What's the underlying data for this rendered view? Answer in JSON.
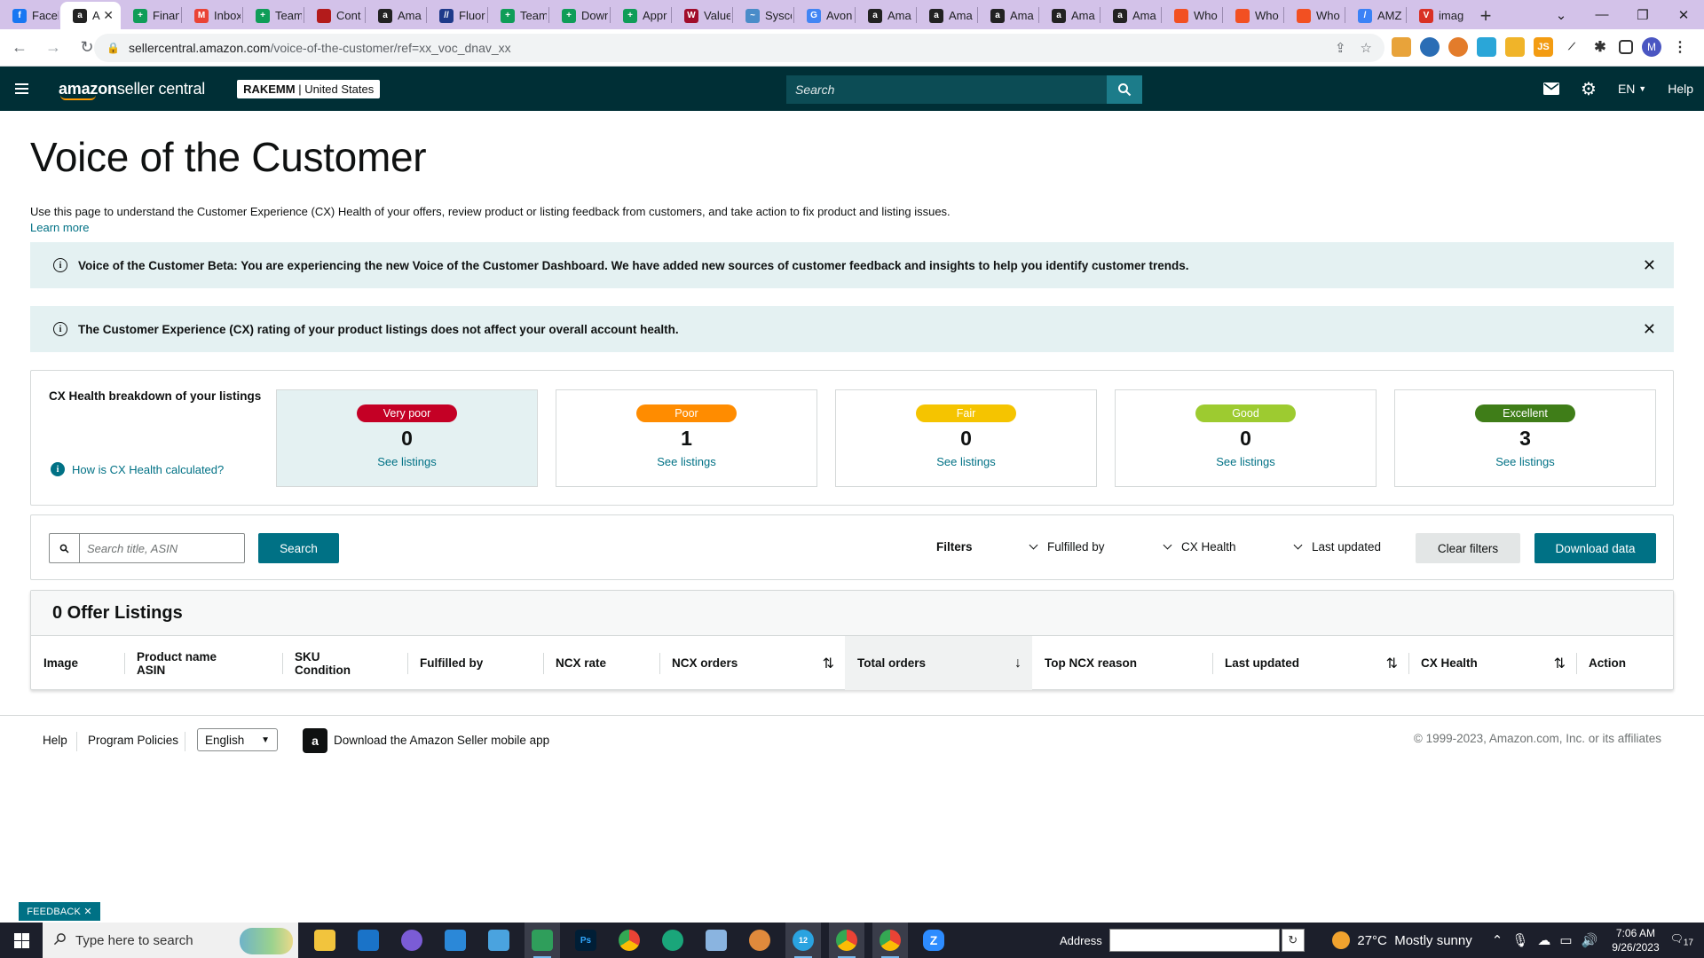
{
  "browser": {
    "tabs": [
      {
        "title": "Faceb",
        "color": "#1877f2",
        "glyph": "f"
      },
      {
        "title": "A",
        "color": "#222222",
        "glyph": "a",
        "active": true
      },
      {
        "title": "Finan",
        "color": "#0f9d58",
        "glyph": "+"
      },
      {
        "title": "Inbox",
        "color": "#ea4335",
        "glyph": "M"
      },
      {
        "title": "Team",
        "color": "#0f9d58",
        "glyph": "+"
      },
      {
        "title": "Cont",
        "color": "#b31b1b",
        "glyph": ""
      },
      {
        "title": "Ama",
        "color": "#222222",
        "glyph": "a"
      },
      {
        "title": "Fluor",
        "color": "#1e3a8a",
        "glyph": "//"
      },
      {
        "title": "Team",
        "color": "#0f9d58",
        "glyph": "+"
      },
      {
        "title": "Down",
        "color": "#0f9d58",
        "glyph": "+"
      },
      {
        "title": "Appr",
        "color": "#0f9d58",
        "glyph": "+"
      },
      {
        "title": "Value",
        "color": "#a10d2b",
        "glyph": "W"
      },
      {
        "title": "Sysco",
        "color": "#4a8cc9",
        "glyph": "~"
      },
      {
        "title": "Avon",
        "color": "#4285f4",
        "glyph": "G"
      },
      {
        "title": "Ama",
        "color": "#222222",
        "glyph": "a"
      },
      {
        "title": "Ama",
        "color": "#222222",
        "glyph": "a"
      },
      {
        "title": "Ama",
        "color": "#222222",
        "glyph": "a"
      },
      {
        "title": "Ama",
        "color": "#222222",
        "glyph": "a"
      },
      {
        "title": "Ama",
        "color": "#222222",
        "glyph": "a"
      },
      {
        "title": "Who",
        "color": "#f25022",
        "glyph": ""
      },
      {
        "title": "Who",
        "color": "#f25022",
        "glyph": ""
      },
      {
        "title": "Who",
        "color": "#f25022",
        "glyph": ""
      },
      {
        "title": "AMZ",
        "color": "#3b82f6",
        "glyph": "/"
      },
      {
        "title": "imag",
        "color": "#d93025",
        "glyph": "V"
      }
    ],
    "url_host": "sellercentral.amazon.com",
    "url_path": "/voice-of-the-customer/ref=xx_voc_dnav_xx",
    "profile_initial": "M"
  },
  "header": {
    "logo_bold": "amazon",
    "logo_rest": " seller central",
    "account_name": "RAKEMM",
    "account_region": "United States",
    "search_placeholder": "Search",
    "language": "EN",
    "help": "Help"
  },
  "page": {
    "title": "Voice of the Customer",
    "description": "Use this page to understand the Customer Experience (CX) Health of your offers, review product or listing feedback from customers, and take action to fix product and listing issues.",
    "learn_more": "Learn more",
    "alerts": [
      {
        "text": "Voice of the Customer Beta: You are experiencing the new Voice of the Customer Dashboard. We have added new sources of customer feedback and insights to help you identify customer trends."
      },
      {
        "text": "The Customer Experience (CX) rating of your product listings does not affect your overall account health."
      }
    ]
  },
  "cx_health": {
    "title": "CX Health breakdown of your listings",
    "how_link": "How is CX Health calculated?",
    "see_listings": "See listings",
    "cards": [
      {
        "label": "Very poor",
        "count": "0",
        "color": "#c40025",
        "selected": true
      },
      {
        "label": "Poor",
        "count": "1",
        "color": "#ff8c00"
      },
      {
        "label": "Fair",
        "count": "0",
        "color": "#f5c400"
      },
      {
        "label": "Good",
        "count": "0",
        "color": "#9dcb30"
      },
      {
        "label": "Excellent",
        "count": "3",
        "color": "#3f7d18"
      }
    ]
  },
  "filters": {
    "search_placeholder": "Search title, ASIN",
    "search_button": "Search",
    "filters_label": "Filters",
    "dropdowns": [
      "Fulfilled by",
      "CX Health",
      "Last updated"
    ],
    "clear_button": "Clear filters",
    "download_button": "Download data"
  },
  "listings": {
    "heading": "0 Offer Listings",
    "columns": [
      {
        "line1": "Image",
        "line2": ""
      },
      {
        "line1": "Product name",
        "line2": "ASIN"
      },
      {
        "line1": "SKU",
        "line2": "Condition"
      },
      {
        "line1": "Fulfilled by",
        "line2": ""
      },
      {
        "line1": "NCX rate",
        "line2": ""
      },
      {
        "line1": "NCX orders",
        "line2": ""
      },
      {
        "line1": "Total orders",
        "line2": ""
      },
      {
        "line1": "Top NCX reason",
        "line2": ""
      },
      {
        "line1": "Last updated",
        "line2": ""
      },
      {
        "line1": "CX Health",
        "line2": ""
      },
      {
        "line1": "Action",
        "line2": ""
      }
    ]
  },
  "footer": {
    "help": "Help",
    "program_policies": "Program Policies",
    "language": "English",
    "app_link": "Download the Amazon Seller mobile app",
    "copyright": "© 1999-2023, Amazon.com, Inc. or its affiliates",
    "feedback": "FEEDBACK"
  },
  "taskbar": {
    "search_placeholder": "Type here to search",
    "address_label": "Address",
    "weather": "27°C  Mostly sunny",
    "time": "7:06 AM",
    "date": "9/26/2023",
    "notification_count": "17",
    "telegram_badge": "12"
  }
}
